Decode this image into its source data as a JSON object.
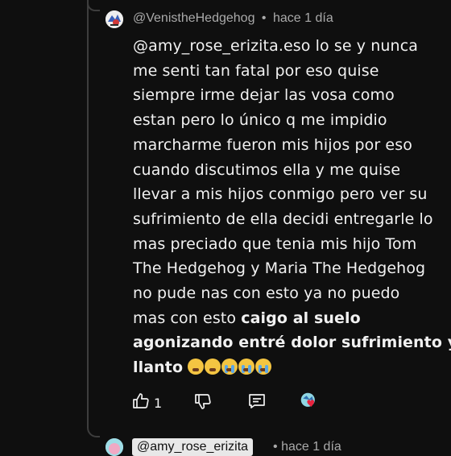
{
  "comment": {
    "author": "@VenistheHedgehog",
    "separator": "•",
    "time": "hace 1 día",
    "lines": [
      "@amy_rose_erizita.eso lo se y nunca",
      "me senti tan fatal  por eso quise",
      "siempre irme dejar las vosa como",
      "estan pero lo único q me impidio",
      "marcharme fueron mis hijos por eso",
      "cuando discutimos ella y me quise",
      "llevar a mis hijos conmigo pero ver su",
      "sufrimiento de ella decidi entregarle lo",
      "mas preciado que tenia mis hijo Tom",
      "The Hedgehog y Maria The Hedgehog",
      "no pude nas con esto ya no puedo"
    ],
    "line12_normal": "mas con esto ",
    "line12_bold": "caigo al suelo",
    "line13_bold": "agonizando entré dolor sufrimiento y",
    "line14_bold": "llanto",
    "emojis": [
      "disappointed-face-emoji",
      "confounded-face-emoji",
      "crying-face-emoji",
      "crying-face-emoji",
      "crying-face-emoji"
    ],
    "like_count": "1"
  },
  "next_comment": {
    "reply_to": "@amy_rose_erizita",
    "separator": "•",
    "time": "hace 1 día"
  },
  "colors": {
    "background": "#0f0f0f",
    "text": "#f1f1f1",
    "meta": "#aaaaaa",
    "thread_line": "#3d3d3d"
  }
}
